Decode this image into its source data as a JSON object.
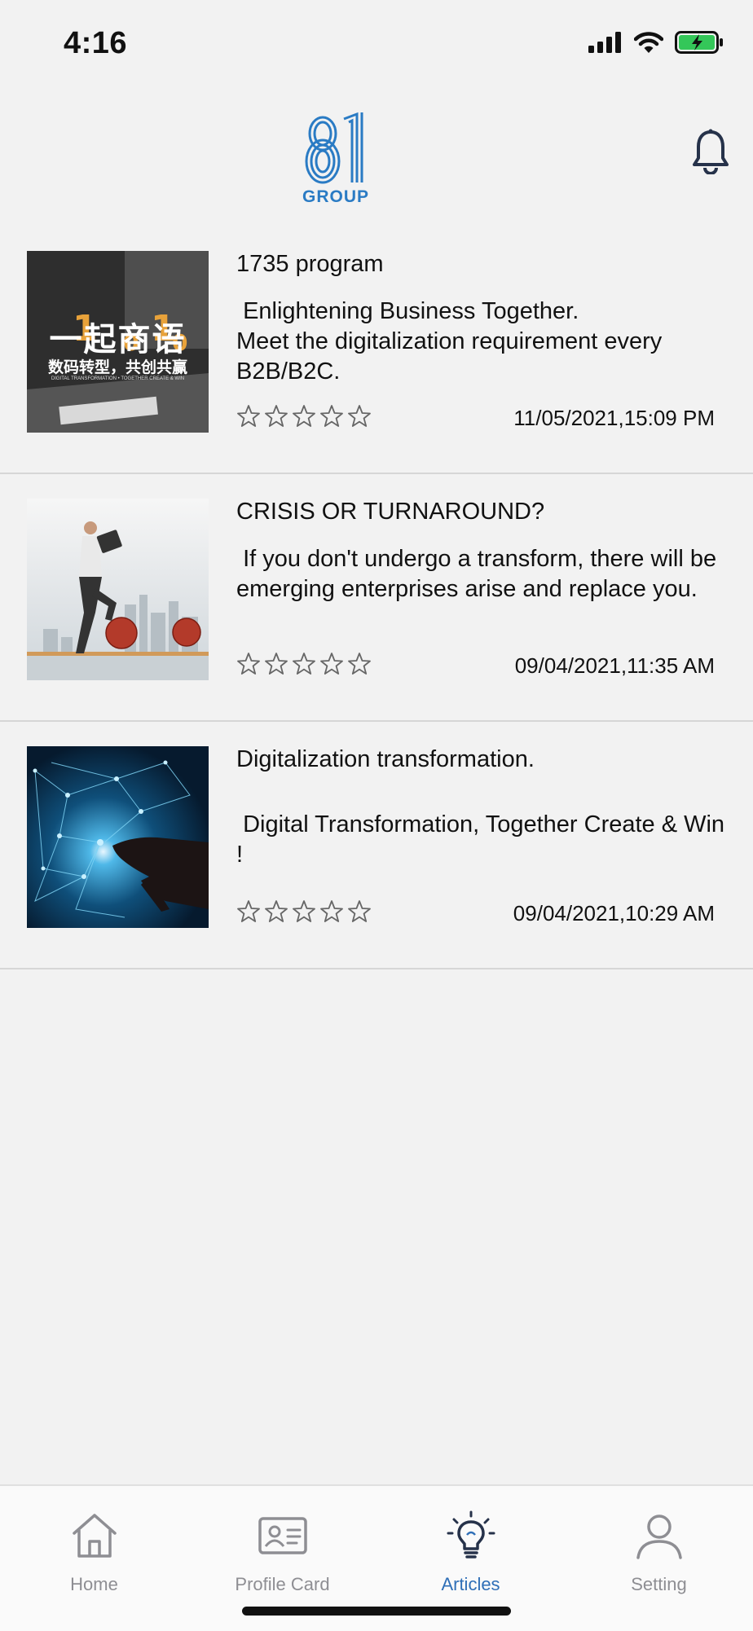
{
  "status_bar": {
    "time": "4:16",
    "battery_color": "#34c759"
  },
  "header": {
    "logo_text": "GROUP",
    "logo_color": "#2a7bc4"
  },
  "articles": [
    {
      "title": "1735 program",
      "description": " Enlightening Business Together.\nMeet the digitalization requirement every B2B/B2C.",
      "date": "11/05/2021,15:09 PM",
      "rating": 0,
      "thumb": {
        "headline": "一起商语",
        "subline": "数码转型，共创共赢",
        "tagline": "DIGITAL TRANSFORMATION • TOGETHER CREATE & WIN"
      }
    },
    {
      "title": "CRISIS OR TURNAROUND?",
      "description": " If you don't undergo a transform, there will be emerging enterprises arise and replace you.",
      "date": "09/04/2021,11:35 AM",
      "rating": 0
    },
    {
      "title": "Digitalization transformation.",
      "description": " Digital Transformation, Together Create & Win !",
      "date": "09/04/2021,10:29 AM",
      "rating": 0
    }
  ],
  "tabs": [
    {
      "label": "Home",
      "icon": "home-icon"
    },
    {
      "label": "Profile Card",
      "icon": "id-card-icon"
    },
    {
      "label": "Articles",
      "icon": "lightbulb-icon",
      "active": true
    },
    {
      "label": "Setting",
      "icon": "user-icon"
    }
  ],
  "colors": {
    "accent": "#2f6fb7",
    "inactive": "#8e8e93",
    "background": "#f2f2f2"
  }
}
